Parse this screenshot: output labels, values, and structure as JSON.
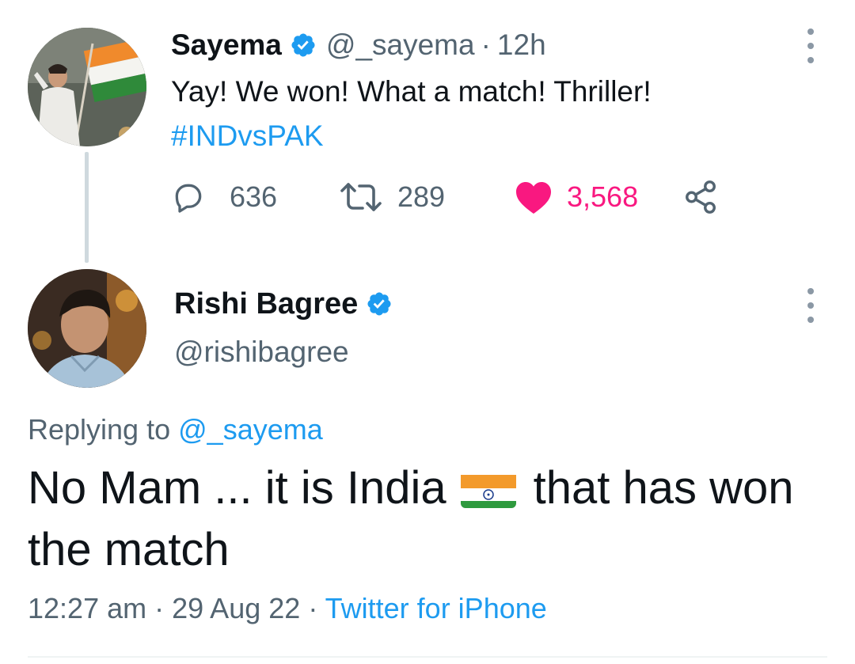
{
  "original_tweet": {
    "author_name": "Sayema",
    "handle": "@_sayema",
    "separator": "·",
    "time": "12h",
    "text_line": "Yay! We won! What a match! Thriller!",
    "hashtag": "#INDvsPAK",
    "replies": "636",
    "retweets": "289",
    "likes": "3,568",
    "liked": true
  },
  "reply_tweet": {
    "author_name": "Rishi Bagree",
    "handle": "@rishibagree",
    "replying_label": "Replying to",
    "replying_to": "@_sayema",
    "text_before_flag": "No Mam ... it is India",
    "flag_icon": "india-flag-icon",
    "text_after_flag": "that has won the match",
    "time": "12:27 am",
    "date": "29 Aug 22",
    "source": "Twitter for iPhone"
  },
  "colors": {
    "link": "#1d9bf0",
    "like": "#f91880",
    "muted": "#536471",
    "verified": "#1d9bf0"
  }
}
